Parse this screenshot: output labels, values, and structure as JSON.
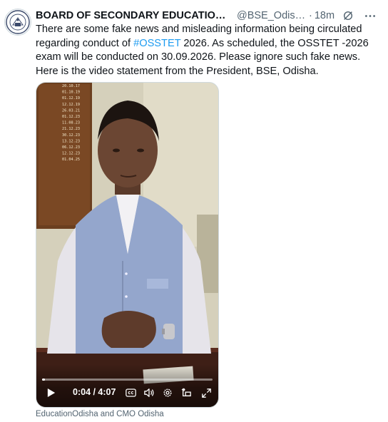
{
  "tweet": {
    "author_name": "BOARD OF SECONDARY EDUCATION, O...",
    "author_handle": "@BSE_Odisha1...",
    "separator": "·",
    "time": "18m",
    "text_before": "There are some fake news and misleading information being circulated regarding conduct of ",
    "hashtag": "#OSSTET",
    "text_after": " 2026. As scheduled, the OSSTET -2026 exam will be conducted on 30.09.2026. Please ignore such fake news. Here is the video statement from the President, BSE, Odisha."
  },
  "video": {
    "timecode": "0:04 / 4:07",
    "progress_fraction": 0.016,
    "board_lines": [
      "20.10.17",
      "01.10.19",
      "01.12.19",
      "12.12.19",
      "26.03.21",
      "01.12.23",
      "11.08.23",
      "21.12.23",
      "30.12.23",
      "13.12.23",
      "06.12.23",
      "12.12.23",
      "01.04.25"
    ]
  },
  "footer": {
    "tagged": "EducationOdisha and CMO Odisha"
  },
  "icons": {
    "avatar": "bse-seal-icon",
    "grok": "grok-icon",
    "more": "more-icon",
    "play": "play-icon",
    "captions": "captions-icon",
    "volume": "volume-icon",
    "settings": "settings-icon",
    "pip": "picture-in-picture-icon",
    "fullscreen": "fullscreen-icon"
  },
  "colors": {
    "hashtag": "#1d9bf0",
    "secondary_text": "#536471",
    "primary_text": "#0f1419"
  }
}
